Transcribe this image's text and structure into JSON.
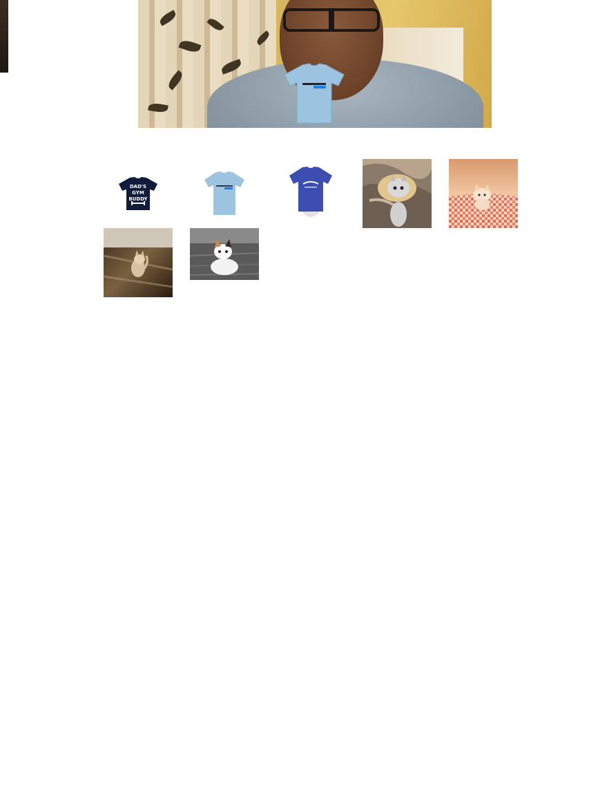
{
  "webcam": {
    "icon": "webcam-feed",
    "overlay": {
      "icon": "tshirt-overlay-icon",
      "color": "#9cc3e0"
    }
  },
  "gallery": {
    "items": [
      {
        "type": "tshirt",
        "color": "#111b3a",
        "print_lines": [
          "DAD'S",
          "GYM",
          "BUDDY"
        ]
      },
      {
        "type": "tshirt",
        "color": "#9cc3e0",
        "print_lines": []
      },
      {
        "type": "tshirt",
        "color": "#3c4fb0",
        "print_lines": []
      },
      {
        "type": "kitten-photo",
        "icon": "kitten-in-bread-icon"
      },
      {
        "type": "kitten-photo",
        "icon": "kitten-on-blanket-icon"
      },
      {
        "type": "kitten-photo",
        "icon": "kitten-on-floor-icon"
      },
      {
        "type": "kitten-photo",
        "icon": "white-kitten-toy-icon"
      }
    ]
  }
}
